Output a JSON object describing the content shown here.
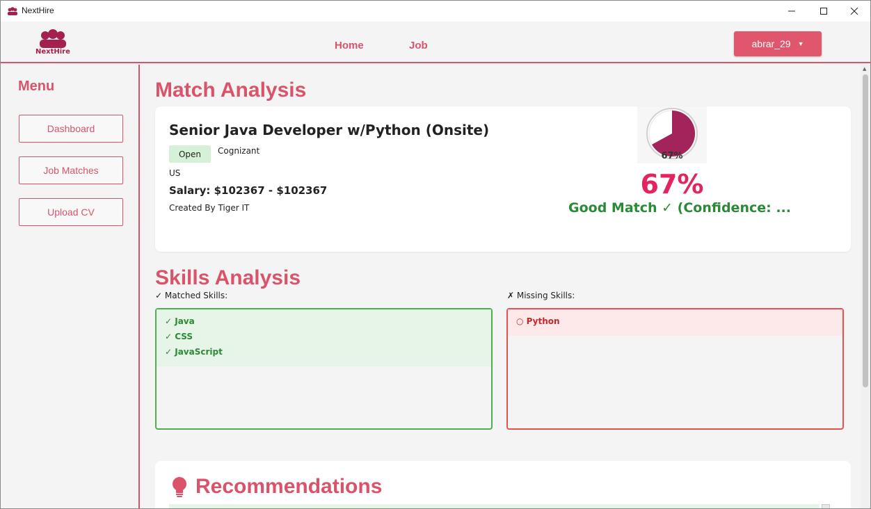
{
  "window": {
    "title": "NextHire"
  },
  "nav": {
    "logo_text": "NextHire",
    "links": [
      "Home",
      "Job"
    ],
    "user": "abrar_29"
  },
  "sidebar": {
    "title": "Menu",
    "items": [
      "Dashboard",
      "Job Matches",
      "Upload CV"
    ]
  },
  "match": {
    "heading": "Match Analysis",
    "job_title": "Senior Java Developer w/Python (Onsite)",
    "status": "Open",
    "company": "Cognizant",
    "location": "US",
    "salary": "Salary: $102367 - $102367",
    "created_by": "Created By Tiger IT",
    "pie_label": "67%",
    "percent_value": 67,
    "percent_text": "67%",
    "verdict": "Good Match ✓ (Confidence: ..."
  },
  "skills": {
    "heading": "Skills Analysis",
    "matched_label": "✓ Matched Skills:",
    "missing_label": "✗ Missing Skills:",
    "matched": [
      "✓ Java",
      "✓ CSS",
      "✓ JavaScript"
    ],
    "missing": [
      "○ Python"
    ]
  },
  "recommendations": {
    "heading": "Recommendations"
  },
  "colors": {
    "accent": "#d9536a",
    "pie_fill": "#a3245a",
    "percent": "#e3245f",
    "good": "#2b8a37",
    "bad": "#c62828"
  }
}
